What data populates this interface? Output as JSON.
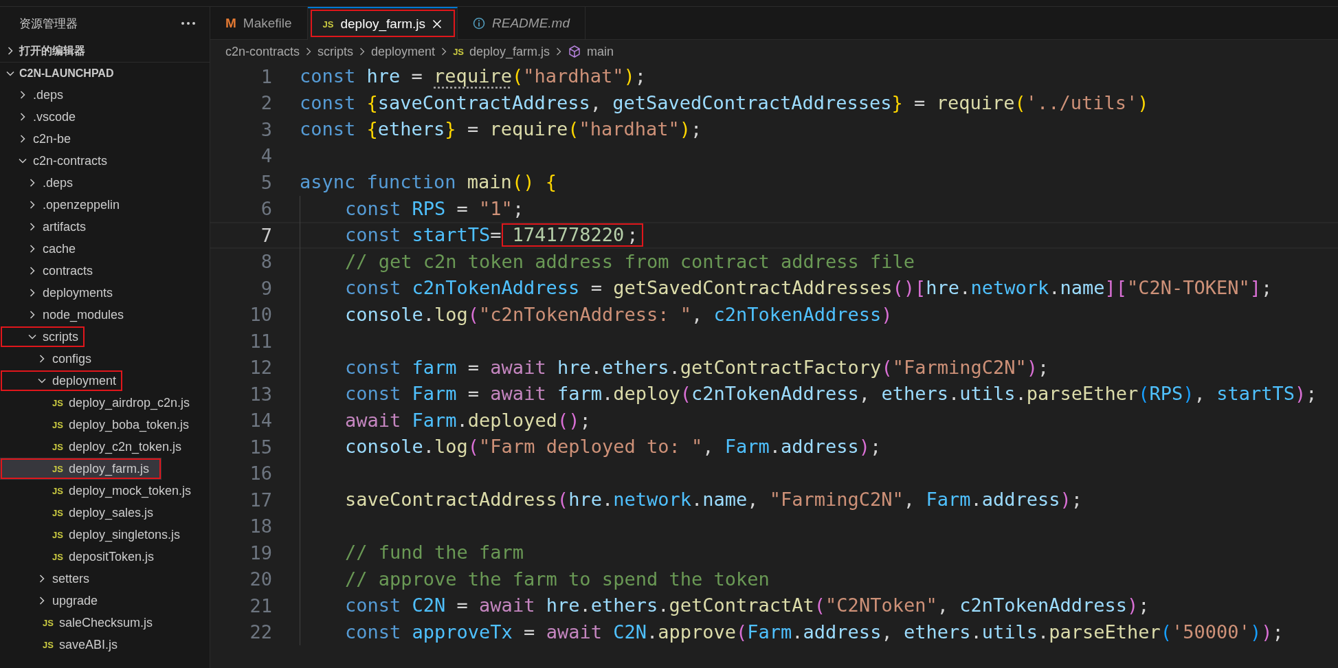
{
  "explorer": {
    "title": "资源管理器",
    "sections": [
      {
        "label": "打开的编辑器",
        "expanded": false
      },
      {
        "label": "C2N-LAUNCHPAD",
        "expanded": true,
        "items": [
          {
            "name": ".deps",
            "kind": "folder",
            "expanded": false,
            "selected": false,
            "outlined": false
          },
          {
            "name": ".vscode",
            "kind": "folder",
            "expanded": false,
            "selected": false,
            "outlined": false
          },
          {
            "name": "c2n-be",
            "kind": "folder",
            "expanded": false,
            "selected": false,
            "outlined": false
          },
          {
            "name": "c2n-contracts",
            "kind": "folder",
            "expanded": true,
            "selected": false,
            "outlined": false,
            "children": [
              {
                "name": ".deps",
                "kind": "folder",
                "expanded": false,
                "selected": false,
                "outlined": false
              },
              {
                "name": ".openzeppelin",
                "kind": "folder",
                "expanded": false,
                "selected": false,
                "outlined": false
              },
              {
                "name": "artifacts",
                "kind": "folder",
                "expanded": false,
                "selected": false,
                "outlined": false
              },
              {
                "name": "cache",
                "kind": "folder",
                "expanded": false,
                "selected": false,
                "outlined": false
              },
              {
                "name": "contracts",
                "kind": "folder",
                "expanded": false,
                "selected": false,
                "outlined": false
              },
              {
                "name": "deployments",
                "kind": "folder",
                "expanded": false,
                "selected": false,
                "outlined": false
              },
              {
                "name": "node_modules",
                "kind": "folder",
                "expanded": false,
                "selected": false,
                "outlined": false
              },
              {
                "name": "scripts",
                "kind": "folder",
                "expanded": true,
                "selected": false,
                "outlined": true,
                "children": [
                  {
                    "name": "configs",
                    "kind": "folder",
                    "expanded": false,
                    "selected": false,
                    "outlined": false
                  },
                  {
                    "name": "deployment",
                    "kind": "folder",
                    "expanded": true,
                    "selected": false,
                    "outlined": true,
                    "children": [
                      {
                        "name": "deploy_airdrop_c2n.js",
                        "kind": "file",
                        "icon_text": "JS",
                        "selected": false,
                        "outlined": false
                      },
                      {
                        "name": "deploy_boba_token.js",
                        "kind": "file",
                        "icon_text": "JS",
                        "selected": false,
                        "outlined": false
                      },
                      {
                        "name": "deploy_c2n_token.js",
                        "kind": "file",
                        "icon_text": "JS",
                        "selected": false,
                        "outlined": false
                      },
                      {
                        "name": "deploy_farm.js",
                        "kind": "file",
                        "icon_text": "JS",
                        "selected": true,
                        "outlined": true
                      },
                      {
                        "name": "deploy_mock_token.js",
                        "kind": "file",
                        "icon_text": "JS",
                        "selected": false,
                        "outlined": false
                      },
                      {
                        "name": "deploy_sales.js",
                        "kind": "file",
                        "icon_text": "JS",
                        "selected": false,
                        "outlined": false
                      },
                      {
                        "name": "deploy_singletons.js",
                        "kind": "file",
                        "icon_text": "JS",
                        "selected": false,
                        "outlined": false
                      },
                      {
                        "name": "depositToken.js",
                        "kind": "file",
                        "icon_text": "JS",
                        "selected": false,
                        "outlined": false
                      }
                    ]
                  },
                  {
                    "name": "setters",
                    "kind": "folder",
                    "expanded": false,
                    "selected": false,
                    "outlined": false
                  },
                  {
                    "name": "upgrade",
                    "kind": "folder",
                    "expanded": false,
                    "selected": false,
                    "outlined": false
                  },
                  {
                    "name": "saleChecksum.js",
                    "kind": "file",
                    "icon_text": "JS",
                    "selected": false,
                    "outlined": false
                  },
                  {
                    "name": "saveABI.js",
                    "kind": "file",
                    "icon_text": "JS",
                    "selected": false,
                    "outlined": false
                  }
                ]
              }
            ]
          }
        ]
      }
    ]
  },
  "tabs": [
    {
      "label": "Makefile",
      "kind": "makefile",
      "icon_text": "M",
      "selected": false,
      "preview": false,
      "outlined": false
    },
    {
      "label": "deploy_farm.js",
      "kind": "javascript",
      "icon_text": "JS",
      "selected": true,
      "preview": false,
      "outlined": true
    },
    {
      "label": "README.md",
      "kind": "markdown",
      "selected": false,
      "preview": true,
      "outlined": false
    }
  ],
  "breadcrumb": [
    {
      "label": "c2n-contracts",
      "kind": "folder"
    },
    {
      "label": "scripts",
      "kind": "folder"
    },
    {
      "label": "deployment",
      "kind": "folder"
    },
    {
      "label": "deploy_farm.js",
      "kind": "file",
      "icon_text": "JS"
    },
    {
      "label": "main",
      "kind": "symbol"
    }
  ],
  "editor": {
    "lines": [
      {
        "number": "1",
        "current": false,
        "indented": false,
        "tokens": [
          {
            "t": "const ",
            "kind": "keyword"
          },
          {
            "t": "hre",
            "kind": "variable"
          },
          {
            "t": " = ",
            "kind": "punct"
          },
          {
            "t": "require",
            "kind": "function",
            "hint": true
          },
          {
            "t": "(",
            "kind": "brace"
          },
          {
            "t": "\"hardhat\"",
            "kind": "string"
          },
          {
            "t": ")",
            "kind": "brace"
          },
          {
            "t": ";",
            "kind": "punct"
          }
        ]
      },
      {
        "number": "2",
        "current": false,
        "indented": false,
        "tokens": [
          {
            "t": "const ",
            "kind": "keyword"
          },
          {
            "t": "{",
            "kind": "brace"
          },
          {
            "t": "saveContractAddress",
            "kind": "variable"
          },
          {
            "t": ", ",
            "kind": "punct"
          },
          {
            "t": "getSavedContractAddresses",
            "kind": "variable"
          },
          {
            "t": "}",
            "kind": "brace"
          },
          {
            "t": " = ",
            "kind": "punct"
          },
          {
            "t": "require",
            "kind": "function"
          },
          {
            "t": "(",
            "kind": "brace"
          },
          {
            "t": "'../utils'",
            "kind": "string"
          },
          {
            "t": ")",
            "kind": "brace"
          }
        ]
      },
      {
        "number": "3",
        "current": false,
        "indented": false,
        "tokens": [
          {
            "t": "const ",
            "kind": "keyword"
          },
          {
            "t": "{",
            "kind": "brace"
          },
          {
            "t": "ethers",
            "kind": "variable"
          },
          {
            "t": "}",
            "kind": "brace"
          },
          {
            "t": " = ",
            "kind": "punct"
          },
          {
            "t": "require",
            "kind": "function"
          },
          {
            "t": "(",
            "kind": "brace"
          },
          {
            "t": "\"hardhat\"",
            "kind": "string"
          },
          {
            "t": ")",
            "kind": "brace"
          },
          {
            "t": ";",
            "kind": "punct"
          }
        ]
      },
      {
        "number": "4",
        "current": false,
        "indented": false
      },
      {
        "number": "5",
        "current": false,
        "indented": false,
        "tokens": [
          {
            "t": "async function ",
            "kind": "keyword"
          },
          {
            "t": "main",
            "kind": "function"
          },
          {
            "t": "() {",
            "kind": "brace"
          }
        ]
      },
      {
        "number": "6",
        "current": false,
        "indented": true,
        "tokens": [
          {
            "t": "const ",
            "kind": "keyword"
          },
          {
            "t": "RPS",
            "kind": "constant"
          },
          {
            "t": " = ",
            "kind": "punct"
          },
          {
            "t": "\"1\"",
            "kind": "string"
          },
          {
            "t": ";",
            "kind": "punct"
          }
        ]
      },
      {
        "number": "7",
        "current": true,
        "indented": true,
        "tokens": [
          {
            "t": "const ",
            "kind": "keyword"
          },
          {
            "t": "startTS",
            "kind": "constant"
          },
          {
            "t": "=",
            "kind": "punct"
          },
          {
            "t": "1741778220",
            "kind": "number",
            "outlined": true
          },
          {
            "t": ";",
            "kind": "punct"
          }
        ]
      },
      {
        "number": "8",
        "current": false,
        "indented": true,
        "tokens": [
          {
            "t": "// get c2n token address from contract address file",
            "kind": "comment"
          }
        ]
      },
      {
        "number": "9",
        "current": false,
        "indented": true,
        "tokens": [
          {
            "t": "const ",
            "kind": "keyword"
          },
          {
            "t": "c2nTokenAddress",
            "kind": "constant"
          },
          {
            "t": " = ",
            "kind": "punct"
          },
          {
            "t": "getSavedContractAddresses",
            "kind": "function"
          },
          {
            "t": "()[",
            "kind": "paren"
          },
          {
            "t": "hre",
            "kind": "variable"
          },
          {
            "t": ".",
            "kind": "punct"
          },
          {
            "t": "network",
            "kind": "constant"
          },
          {
            "t": ".",
            "kind": "punct"
          },
          {
            "t": "name",
            "kind": "variable"
          },
          {
            "t": "][",
            "kind": "paren"
          },
          {
            "t": "\"C2N-TOKEN\"",
            "kind": "string"
          },
          {
            "t": "]",
            "kind": "paren"
          },
          {
            "t": ";",
            "kind": "punct"
          }
        ]
      },
      {
        "number": "10",
        "current": false,
        "indented": true,
        "tokens": [
          {
            "t": "console",
            "kind": "variable"
          },
          {
            "t": ".",
            "kind": "punct"
          },
          {
            "t": "log",
            "kind": "function"
          },
          {
            "t": "(",
            "kind": "paren"
          },
          {
            "t": "\"c2nTokenAddress: \"",
            "kind": "string"
          },
          {
            "t": ", ",
            "kind": "punct"
          },
          {
            "t": "c2nTokenAddress",
            "kind": "constant"
          },
          {
            "t": ")",
            "kind": "paren"
          }
        ]
      },
      {
        "number": "11",
        "current": false,
        "indented": true
      },
      {
        "number": "12",
        "current": false,
        "indented": true,
        "tokens": [
          {
            "t": "const ",
            "kind": "keyword"
          },
          {
            "t": "farm",
            "kind": "constant"
          },
          {
            "t": " = ",
            "kind": "punct"
          },
          {
            "t": "await ",
            "kind": "control"
          },
          {
            "t": "hre",
            "kind": "variable"
          },
          {
            "t": ".",
            "kind": "punct"
          },
          {
            "t": "ethers",
            "kind": "variable"
          },
          {
            "t": ".",
            "kind": "punct"
          },
          {
            "t": "getContractFactory",
            "kind": "function"
          },
          {
            "t": "(",
            "kind": "paren"
          },
          {
            "t": "\"FarmingC2N\"",
            "kind": "string"
          },
          {
            "t": ")",
            "kind": "paren"
          },
          {
            "t": ";",
            "kind": "punct"
          }
        ]
      },
      {
        "number": "13",
        "current": false,
        "indented": true,
        "tokens": [
          {
            "t": "const ",
            "kind": "keyword"
          },
          {
            "t": "Farm",
            "kind": "constant"
          },
          {
            "t": " = ",
            "kind": "punct"
          },
          {
            "t": "await ",
            "kind": "control"
          },
          {
            "t": "farm",
            "kind": "variable"
          },
          {
            "t": ".",
            "kind": "punct"
          },
          {
            "t": "deploy",
            "kind": "function"
          },
          {
            "t": "(",
            "kind": "paren"
          },
          {
            "t": "c2nTokenAddress",
            "kind": "variable"
          },
          {
            "t": ", ",
            "kind": "punct"
          },
          {
            "t": "ethers",
            "kind": "variable"
          },
          {
            "t": ".",
            "kind": "punct"
          },
          {
            "t": "utils",
            "kind": "variable"
          },
          {
            "t": ".",
            "kind": "punct"
          },
          {
            "t": "parseEther",
            "kind": "function"
          },
          {
            "t": "(",
            "kind": "bracket"
          },
          {
            "t": "RPS",
            "kind": "constant"
          },
          {
            "t": ")",
            "kind": "bracket"
          },
          {
            "t": ", ",
            "kind": "punct"
          },
          {
            "t": "startTS",
            "kind": "constant"
          },
          {
            "t": ")",
            "kind": "paren"
          },
          {
            "t": ";",
            "kind": "punct"
          }
        ]
      },
      {
        "number": "14",
        "current": false,
        "indented": true,
        "tokens": [
          {
            "t": "await ",
            "kind": "control"
          },
          {
            "t": "Farm",
            "kind": "constant"
          },
          {
            "t": ".",
            "kind": "punct"
          },
          {
            "t": "deployed",
            "kind": "function"
          },
          {
            "t": "()",
            "kind": "paren"
          },
          {
            "t": ";",
            "kind": "punct"
          }
        ]
      },
      {
        "number": "15",
        "current": false,
        "indented": true,
        "tokens": [
          {
            "t": "console",
            "kind": "variable"
          },
          {
            "t": ".",
            "kind": "punct"
          },
          {
            "t": "log",
            "kind": "function"
          },
          {
            "t": "(",
            "kind": "paren"
          },
          {
            "t": "\"Farm deployed to: \"",
            "kind": "string"
          },
          {
            "t": ", ",
            "kind": "punct"
          },
          {
            "t": "Farm",
            "kind": "constant"
          },
          {
            "t": ".",
            "kind": "punct"
          },
          {
            "t": "address",
            "kind": "variable"
          },
          {
            "t": ")",
            "kind": "paren"
          },
          {
            "t": ";",
            "kind": "punct"
          }
        ]
      },
      {
        "number": "16",
        "current": false,
        "indented": true
      },
      {
        "number": "17",
        "current": false,
        "indented": true,
        "tokens": [
          {
            "t": "saveContractAddress",
            "kind": "function"
          },
          {
            "t": "(",
            "kind": "paren"
          },
          {
            "t": "hre",
            "kind": "variable"
          },
          {
            "t": ".",
            "kind": "punct"
          },
          {
            "t": "network",
            "kind": "constant"
          },
          {
            "t": ".",
            "kind": "punct"
          },
          {
            "t": "name",
            "kind": "variable"
          },
          {
            "t": ", ",
            "kind": "punct"
          },
          {
            "t": "\"FarmingC2N\"",
            "kind": "string"
          },
          {
            "t": ", ",
            "kind": "punct"
          },
          {
            "t": "Farm",
            "kind": "constant"
          },
          {
            "t": ".",
            "kind": "punct"
          },
          {
            "t": "address",
            "kind": "variable"
          },
          {
            "t": ")",
            "kind": "paren"
          },
          {
            "t": ";",
            "kind": "punct"
          }
        ]
      },
      {
        "number": "18",
        "current": false,
        "indented": true
      },
      {
        "number": "19",
        "current": false,
        "indented": true,
        "tokens": [
          {
            "t": "// fund the farm",
            "kind": "comment"
          }
        ]
      },
      {
        "number": "20",
        "current": false,
        "indented": true,
        "tokens": [
          {
            "t": "// approve the farm to spend the token",
            "kind": "comment"
          }
        ]
      },
      {
        "number": "21",
        "current": false,
        "indented": true,
        "tokens": [
          {
            "t": "const ",
            "kind": "keyword"
          },
          {
            "t": "C2N",
            "kind": "constant"
          },
          {
            "t": " = ",
            "kind": "punct"
          },
          {
            "t": "await ",
            "kind": "control"
          },
          {
            "t": "hre",
            "kind": "variable"
          },
          {
            "t": ".",
            "kind": "punct"
          },
          {
            "t": "ethers",
            "kind": "variable"
          },
          {
            "t": ".",
            "kind": "punct"
          },
          {
            "t": "getContractAt",
            "kind": "function"
          },
          {
            "t": "(",
            "kind": "paren"
          },
          {
            "t": "\"C2NToken\"",
            "kind": "string"
          },
          {
            "t": ", ",
            "kind": "punct"
          },
          {
            "t": "c2nTokenAddress",
            "kind": "variable"
          },
          {
            "t": ")",
            "kind": "paren"
          },
          {
            "t": ";",
            "kind": "punct"
          }
        ]
      },
      {
        "number": "22",
        "current": false,
        "indented": true,
        "tokens": [
          {
            "t": "const ",
            "kind": "keyword"
          },
          {
            "t": "approveTx",
            "kind": "constant"
          },
          {
            "t": " = ",
            "kind": "punct"
          },
          {
            "t": "await ",
            "kind": "control"
          },
          {
            "t": "C2N",
            "kind": "constant"
          },
          {
            "t": ".",
            "kind": "punct"
          },
          {
            "t": "approve",
            "kind": "function"
          },
          {
            "t": "(",
            "kind": "paren"
          },
          {
            "t": "Farm",
            "kind": "constant"
          },
          {
            "t": ".",
            "kind": "punct"
          },
          {
            "t": "address",
            "kind": "variable"
          },
          {
            "t": ", ",
            "kind": "punct"
          },
          {
            "t": "ethers",
            "kind": "variable"
          },
          {
            "t": ".",
            "kind": "punct"
          },
          {
            "t": "utils",
            "kind": "variable"
          },
          {
            "t": ".",
            "kind": "punct"
          },
          {
            "t": "parseEther",
            "kind": "function"
          },
          {
            "t": "(",
            "kind": "bracket"
          },
          {
            "t": "'50000'",
            "kind": "string"
          },
          {
            "t": ")",
            "kind": "bracket"
          },
          {
            "t": ")",
            "kind": "paren"
          },
          {
            "t": ";",
            "kind": "punct"
          }
        ]
      }
    ]
  }
}
